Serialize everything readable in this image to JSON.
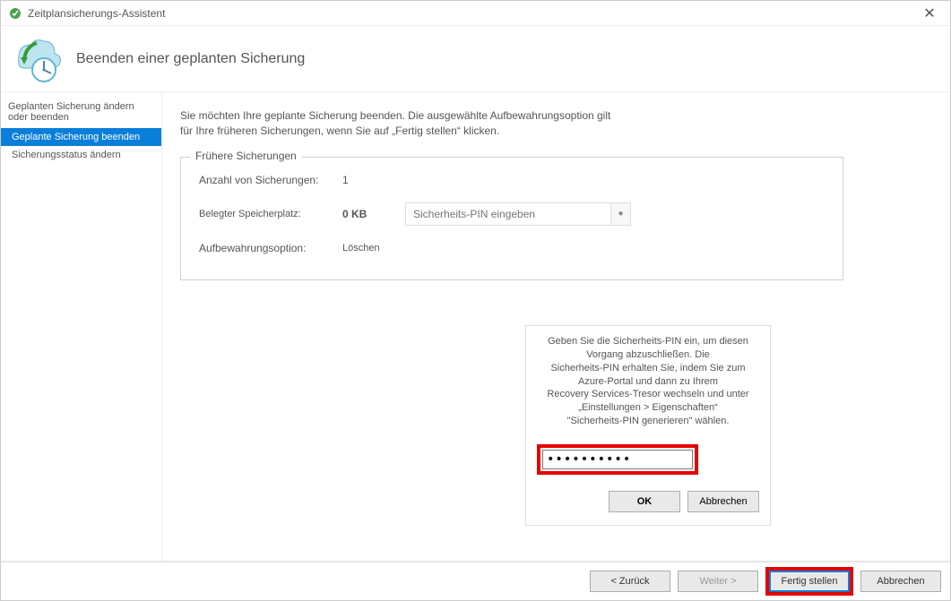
{
  "window": {
    "title": "Zeitplansicherungs-Assistent"
  },
  "header": {
    "title": "Beenden einer geplanten Sicherung"
  },
  "sidebar": {
    "heading": "Geplanten Sicherung ändern oder beenden",
    "items": [
      {
        "label": "Geplante Sicherung beenden",
        "selected": true
      },
      {
        "label": "Sicherungsstatus ändern",
        "selected": false
      }
    ]
  },
  "main": {
    "intro_line1": "Sie möchten Ihre geplante Sicherung beenden. Die ausgewählte Aufbewahrungsoption gilt",
    "intro_line2": "für Ihre früheren Sicherungen, wenn Sie auf „Fertig stellen“ klicken.",
    "group_title": "Frühere Sicherungen",
    "count_label": "Anzahl von Sicherungen:",
    "count_value": "1",
    "space_label": "Belegter Speicherplatz:",
    "space_value": "0 KB",
    "retention_label": "Aufbewahrungsoption:",
    "retention_value": "Löschen",
    "pin_placeholder": "Sicherheits-PIN eingeben"
  },
  "pin_dialog": {
    "msg_l1": "Geben Sie die Sicherheits-PIN ein, um diesen Vorgang abzuschließen. Die",
    "msg_l2": "Sicherheits-PIN erhalten Sie, indem Sie zum Azure-Portal und dann zu Ihrem",
    "msg_l3": "Recovery Services-Tresor wechseln und unter „Einstellungen > Eigenschaften“",
    "msg_l4": "\"Sicherheits-PIN generieren\" wählen.",
    "password_mask": "••••••••••",
    "ok": "OK",
    "cancel": "Abbrechen"
  },
  "footer": {
    "back": "<  Zurück",
    "next": "Weiter  >",
    "finish": "Fertig stellen",
    "cancel": "Abbrechen"
  }
}
